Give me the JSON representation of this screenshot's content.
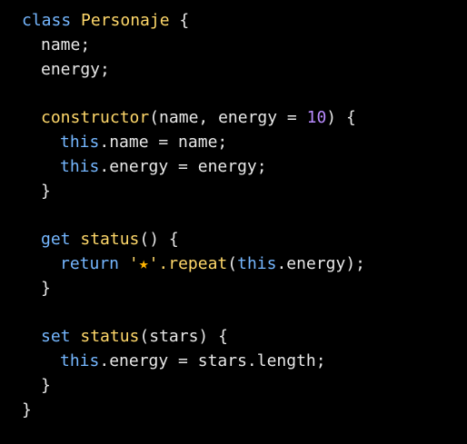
{
  "colors": {
    "background": "#000000",
    "text": "#e8e8e8",
    "keyword": "#75b7ff",
    "function": "#ffd86a",
    "number": "#b98bff",
    "string": "#ffd86a",
    "star": "#ffb400"
  },
  "code": {
    "l1": {
      "kw": "class",
      "name": "Personaje",
      "rest": " {"
    },
    "l2": {
      "text": "name;"
    },
    "l3": {
      "text": "energy;"
    },
    "l5": {
      "fn": "constructor",
      "args_open": "(name, energy = ",
      "num": "10",
      "args_close": ") {"
    },
    "l6": {
      "kw": "this",
      "rest": ".name = name;"
    },
    "l7": {
      "kw": "this",
      "rest": ".energy = energy;"
    },
    "l8": {
      "text": "}"
    },
    "l10": {
      "kw": "get",
      "fn": "status",
      "rest": "() {"
    },
    "l11": {
      "kw": "return",
      "quote_open": "'",
      "star": "★",
      "quote_close": "'",
      "method": ".repeat",
      "paren_open": "(",
      "kw2": "this",
      "rest": ".energy);"
    },
    "l12": {
      "text": "}"
    },
    "l14": {
      "kw": "set",
      "fn": "status",
      "rest": "(stars) {"
    },
    "l15": {
      "kw": "this",
      "rest": ".energy = stars.length;"
    },
    "l16": {
      "text": "}"
    },
    "l17": {
      "text": "}"
    }
  }
}
